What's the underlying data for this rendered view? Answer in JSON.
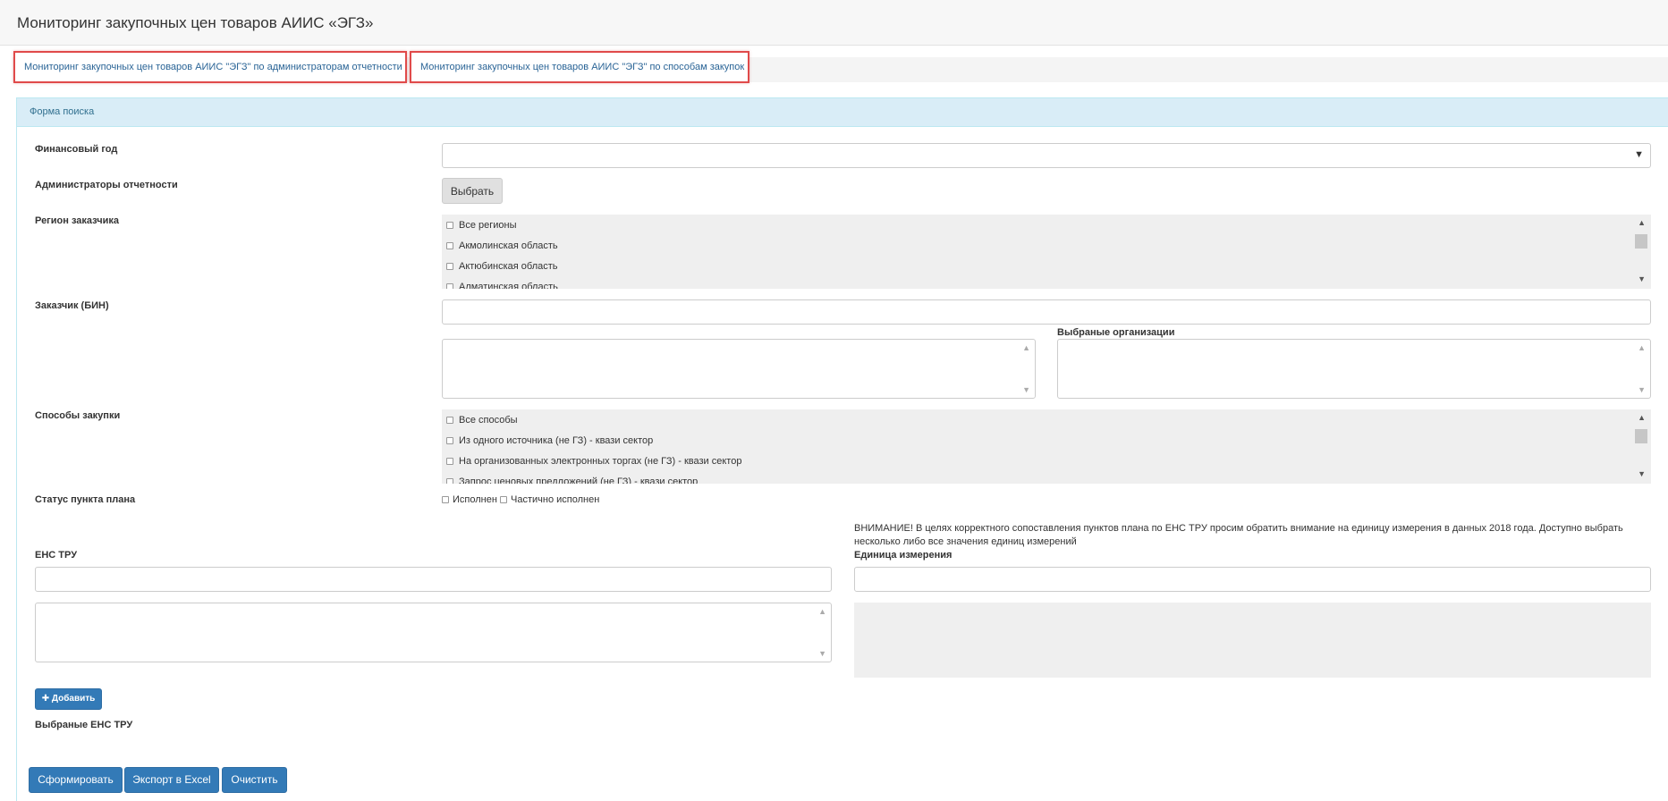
{
  "header": {
    "title": "Мониторинг закупочных цен товаров АИИС «ЭГЗ»"
  },
  "tabs": [
    {
      "label": "Мониторинг закупочных цен товаров АИИС \"ЭГЗ\" по администраторам отчетности"
    },
    {
      "label": "Мониторинг закупочных цен товаров АИИС \"ЭГЗ\" по способам закупок"
    }
  ],
  "panel": {
    "title": "Форма поиска"
  },
  "form": {
    "fiscal_year": {
      "label": "Финансовый год",
      "value": ""
    },
    "admins": {
      "label": "Администраторы отчетности",
      "button": "Выбрать"
    },
    "region": {
      "label": "Регион заказчика",
      "options": [
        "Все регионы",
        "Акмолинская область",
        "Актюбинская область",
        "Алматинская область"
      ]
    },
    "customer": {
      "label": "Заказчик (БИН)",
      "value": "",
      "selected_label": "Выбраные организации"
    },
    "methods": {
      "label": "Способы закупки",
      "options": [
        "Все способы",
        "Из одного источника (не ГЗ) - квази сектор",
        "На организованных электронных торгах (не ГЗ) - квази сектор",
        "Запрос ценовых предложений (не ГЗ) - квази сектор"
      ]
    },
    "plan_status": {
      "label": "Статус пункта плана",
      "options": [
        "Исполнен",
        "Частично исполнен"
      ]
    },
    "warning": "ВНИМАНИЕ! В целях корректного сопоставления пунктов плана по ЕНС ТРУ просим обратить внимание на единицу измерения в данных 2018 года. Доступно выбрать несколько либо все значения единиц измерений",
    "ens": {
      "label": "ЕНС ТРУ",
      "value": ""
    },
    "unit": {
      "label": "Единица измерения",
      "value": ""
    },
    "add_button": "Добавить",
    "selected_ens_label": "Выбраные ЕНС ТРУ"
  },
  "actions": {
    "generate": "Сформировать",
    "export": "Экспорт в Excel",
    "clear": "Очистить"
  },
  "icons": [
    "caret-down-icon",
    "plus-icon",
    "checkbox-icon",
    "scroll-up-icon",
    "scroll-down-icon"
  ],
  "colors": {
    "primary": "#337ab7",
    "panel_header": "#d9edf7",
    "highlight_border": "#e04a4a"
  }
}
